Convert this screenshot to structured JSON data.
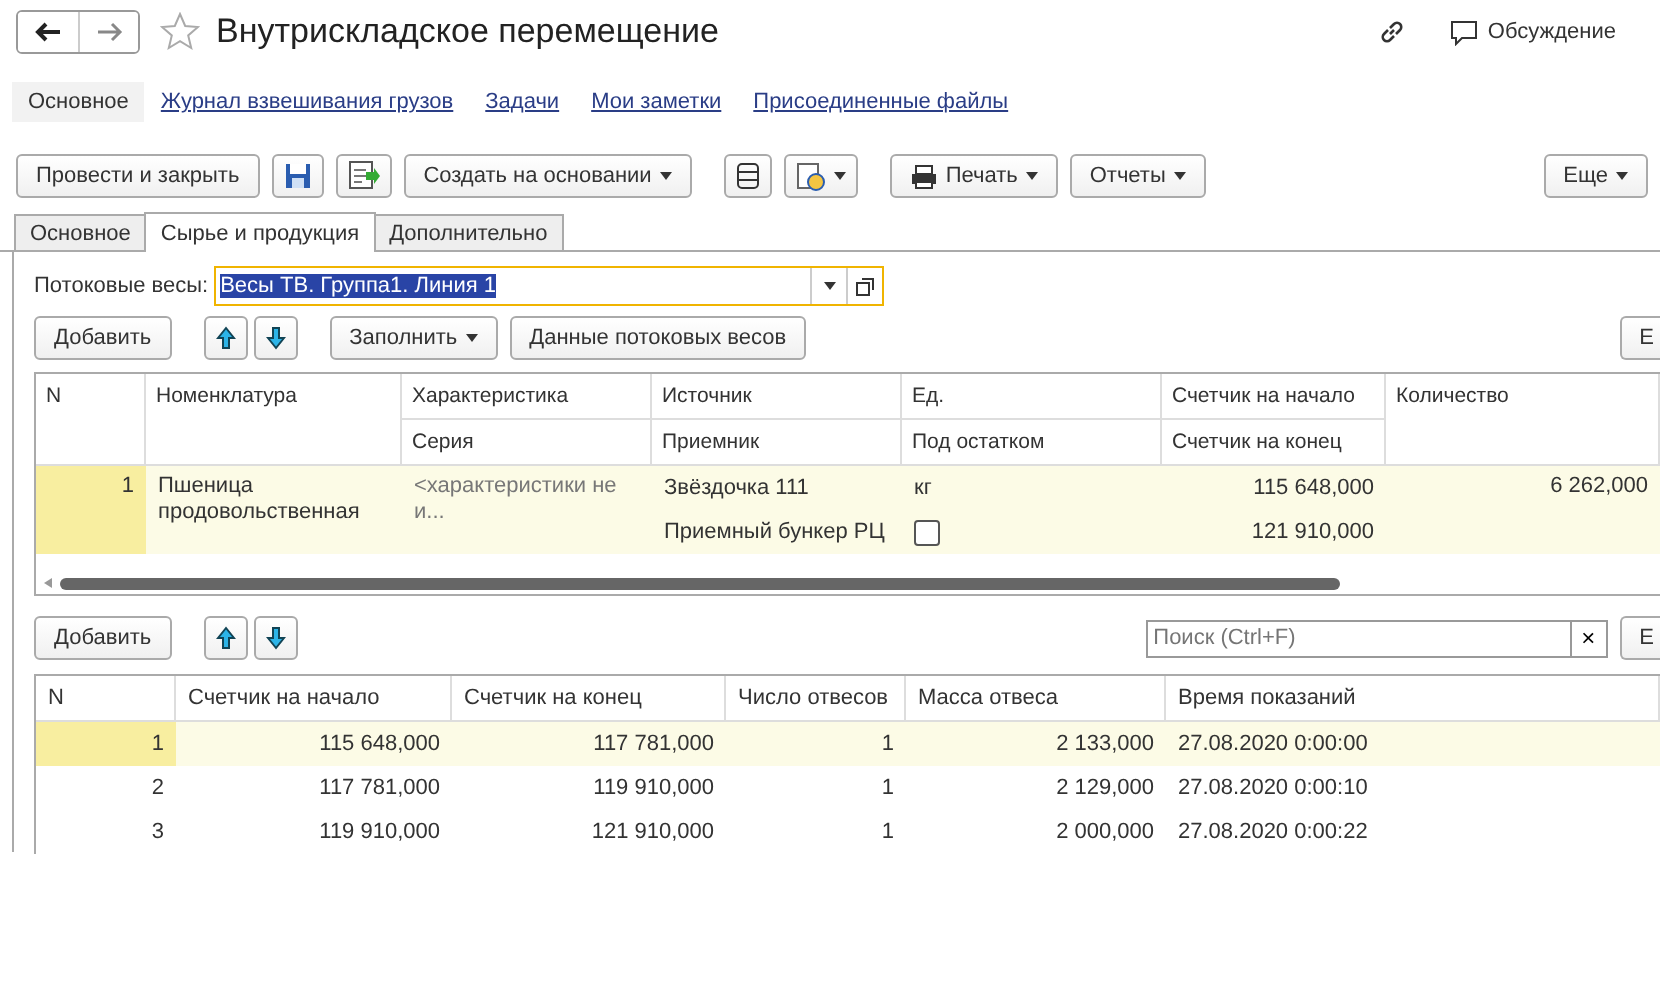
{
  "window": {
    "title": "Внутрискладское перемещение",
    "discussion": "Обсуждение"
  },
  "nav": [
    {
      "label": "Основное",
      "selected": true
    },
    {
      "label": "Журнал взвешивания грузов",
      "selected": false
    },
    {
      "label": "Задачи",
      "selected": false
    },
    {
      "label": "Мои заметки",
      "selected": false
    },
    {
      "label": "Присоединенные файлы",
      "selected": false
    }
  ],
  "toolbar": {
    "post_close": "Провести и закрыть",
    "create_based": "Создать на основании",
    "print": "Печать",
    "reports": "Отчеты",
    "more": "Еще"
  },
  "tabs": [
    {
      "label": "Основное",
      "selected": false
    },
    {
      "label": "Сырье и продукция",
      "selected": true
    },
    {
      "label": "Дополнительно",
      "selected": false
    }
  ],
  "scales_field": {
    "label": "Потоковые весы:",
    "value": "Весы ТВ. Группа1. Линия 1"
  },
  "table_toolbar": {
    "add": "Добавить",
    "fill": "Заполнить",
    "scales_data": "Данные потоковых весов",
    "more": "Е"
  },
  "table": {
    "columns": [
      [
        "N",
        ""
      ],
      [
        "Номенклатура",
        ""
      ],
      [
        "Характеристика",
        "Серия"
      ],
      [
        "Источник",
        "Приемник"
      ],
      [
        "Ед.",
        "Под остатком"
      ],
      [
        "Счетчик на начало",
        "Счетчик на конец"
      ],
      [
        "Количество",
        ""
      ]
    ],
    "rows": [
      {
        "n": "1",
        "item": "Пшеница продовольственная",
        "characteristic": "<характеристики не и...",
        "source": "Звёздочка 111",
        "receiver": "Приемный бункер РЦ",
        "unit": "кг",
        "under_balance": false,
        "start": "115 648,000",
        "end": "121 910,000",
        "quantity": "6 262,000",
        "selected": true
      }
    ]
  },
  "readings_toolbar": {
    "add": "Добавить",
    "search_placeholder": "Поиск (Ctrl+F)",
    "clear": "×",
    "more": "Е"
  },
  "readings": {
    "columns": [
      "N",
      "Счетчик на начало",
      "Счетчик на конец",
      "Число отвесов",
      "Масса отвеса",
      "Время показаний"
    ],
    "rows": [
      {
        "cells": [
          "1",
          "115 648,000",
          "117 781,000",
          "1",
          "2 133,000",
          "27.08.2020 0:00:00"
        ],
        "selected": true
      },
      {
        "cells": [
          "2",
          "117 781,000",
          "119 910,000",
          "1",
          "2 129,000",
          "27.08.2020 0:00:10"
        ],
        "selected": false
      },
      {
        "cells": [
          "3",
          "119 910,000",
          "121 910,000",
          "1",
          "2 000,000",
          "27.08.2020 0:00:22"
        ],
        "selected": false
      }
    ]
  }
}
